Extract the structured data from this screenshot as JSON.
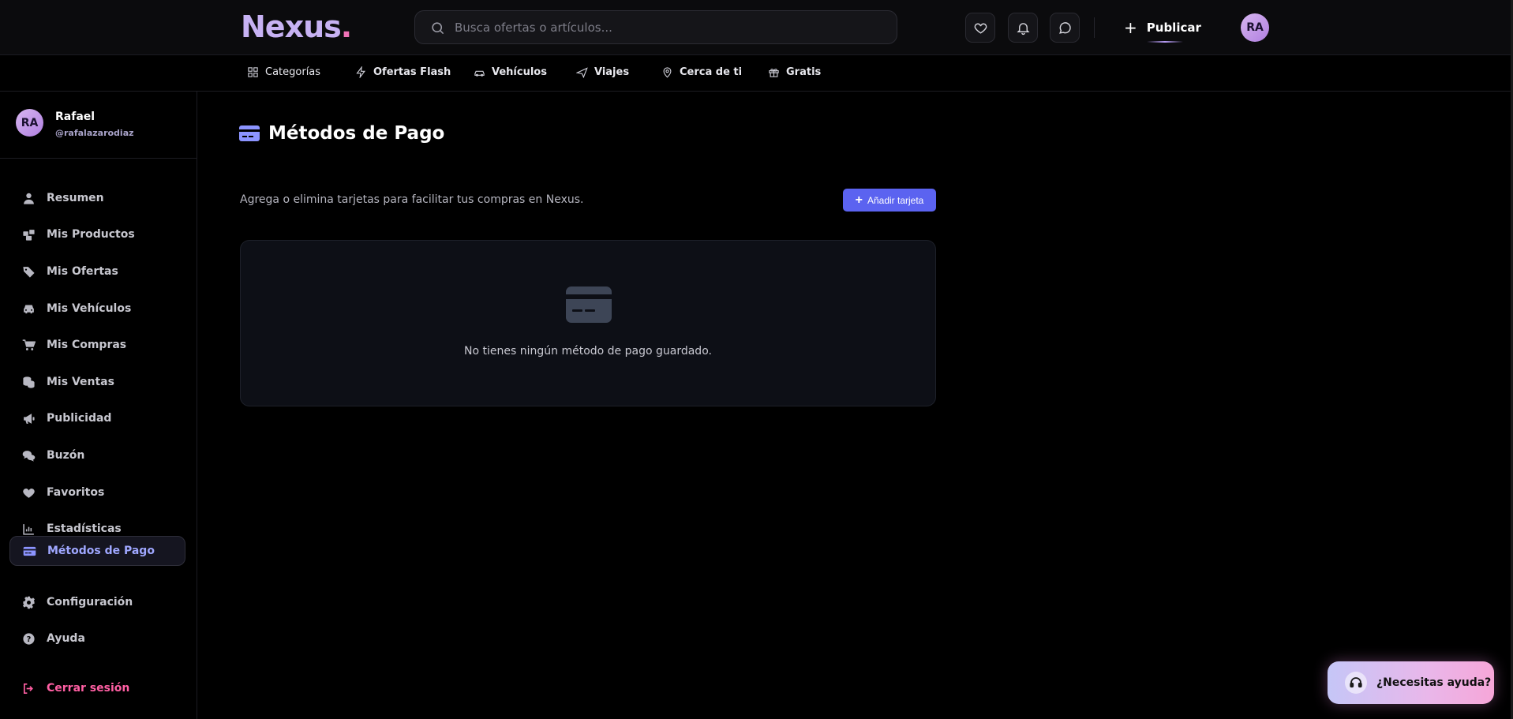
{
  "brand": {
    "name": "Nexus",
    "dot": ".",
    "accent": "#c7b2f3",
    "dot_color": "#f072b6"
  },
  "search": {
    "placeholder": "Busca ofertas o artículos..."
  },
  "header": {
    "icons": [
      "heart-icon",
      "bell-icon",
      "chat-icon"
    ],
    "publish_label": "Publicar",
    "avatar_initials": "RA"
  },
  "nav": {
    "items": [
      {
        "label": "Categorías",
        "icon": "grid-icon"
      },
      {
        "label": "Ofertas Flash",
        "icon": "bolt-icon"
      },
      {
        "label": "Vehículos",
        "icon": "car-icon"
      },
      {
        "label": "Viajes",
        "icon": "plane-icon"
      },
      {
        "label": "Cerca de ti",
        "icon": "pin-icon"
      },
      {
        "label": "Gratis",
        "icon": "gift-icon"
      }
    ]
  },
  "profile": {
    "initials": "RA",
    "name": "Rafael",
    "username": "@rafalazarodiaz"
  },
  "sidebar": {
    "items": [
      {
        "label": "Resumen",
        "icon": "user-icon"
      },
      {
        "label": "Mis Productos",
        "icon": "boxes-icon"
      },
      {
        "label": "Mis Ofertas",
        "icon": "tags-icon"
      },
      {
        "label": "Mis Vehículos",
        "icon": "car-icon"
      },
      {
        "label": "Mis Compras",
        "icon": "cart-icon"
      },
      {
        "label": "Mis Ventas",
        "icon": "coins-icon"
      },
      {
        "label": "Publicidad",
        "icon": "megaphone-icon"
      },
      {
        "label": "Buzón",
        "icon": "comments-icon"
      },
      {
        "label": "Favoritos",
        "icon": "heart-icon"
      },
      {
        "label": "Estadísticas",
        "icon": "chart-icon"
      },
      {
        "label": "Métodos de Pago",
        "icon": "credit-card-icon",
        "active": true
      },
      {
        "label": "Configuración",
        "icon": "gear-icon"
      },
      {
        "label": "Ayuda",
        "icon": "question-icon"
      }
    ],
    "logout_label": "Cerrar sesión"
  },
  "main": {
    "title": "Métodos de Pago",
    "subtitle": "Agrega o elimina tarjetas para facilitar tus compras en Nexus.",
    "add_button": "Añadir tarjeta",
    "empty_message": "No tienes ningún método de pago guardado."
  },
  "help": {
    "label": "¿Necesitas ayuda?"
  },
  "colors": {
    "primary": "#5b63f0",
    "active_text": "#9fa7ff",
    "logout": "#ff5fa3",
    "card_bg": "#0d0f16"
  }
}
